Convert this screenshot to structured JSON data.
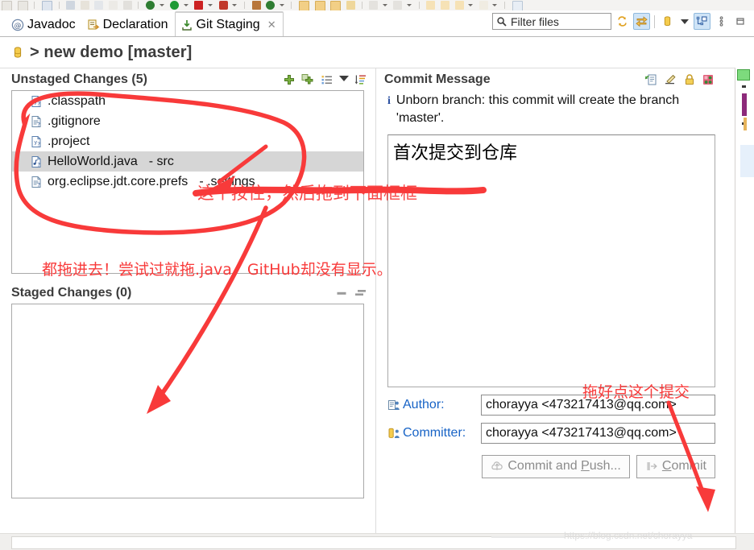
{
  "global_toolbar": {
    "name": "eclipse-main-toolbar",
    "icons": [
      "save-icon",
      "save-all-icon",
      "search-icon",
      "debug-icon",
      "run-last-icon",
      "external-tools-icon",
      "new-java-class-icon",
      "new-package-icon",
      "pause-icon",
      "git-push-icon",
      "run-icon",
      "coverage-icon",
      "debug-red-icon",
      "open-book-icon",
      "validate-icon",
      "folder-icon",
      "folder-icon-2",
      "folder-icon-3",
      "pencil-icon",
      "new-wizard-icon",
      "next-annotation-icon",
      "back-icon",
      "forward-icon",
      "forward-2-icon",
      "jump-icon",
      "new-window-icon"
    ]
  },
  "tabs": [
    {
      "label": "Javadoc",
      "icon": "javadoc-icon",
      "active": false,
      "closable": false
    },
    {
      "label": "Declaration",
      "icon": "declaration-icon",
      "active": false,
      "closable": false
    },
    {
      "label": "Git Staging",
      "icon": "git-staging-icon",
      "active": true,
      "closable": true
    }
  ],
  "tab_close_glyph": "✕",
  "view_toolbar": {
    "filter": {
      "value": "Filter files",
      "placeholder": "Filter files",
      "icon": "search-icon"
    },
    "buttons": [
      {
        "name": "refresh-icon",
        "label": "Refresh",
        "toggled": false
      },
      {
        "name": "link-selection-icon",
        "label": "Link with Editor and Selection",
        "toggled": true
      },
      {
        "name": "repository-icon",
        "label": "Repository",
        "toggled": false
      },
      {
        "name": "repository-dropdown-caret",
        "label": "Select repository",
        "toggled": false
      },
      {
        "name": "presentation-icon",
        "label": "Presentation",
        "toggled": true
      },
      {
        "name": "view-menu-icon",
        "label": "View Menu",
        "toggled": false
      },
      {
        "name": "minimize-view-icon",
        "label": "Minimize",
        "toggled": false
      }
    ]
  },
  "repository": {
    "icon": "repository-icon",
    "separator": ">",
    "name": "new demo",
    "branch": "[master]",
    "title": "> new demo [master]"
  },
  "unstaged": {
    "title": "Unstaged Changes (5)",
    "count": 5,
    "tools": [
      {
        "name": "add-to-index-icon",
        "label": "Add selected files to the index"
      },
      {
        "name": "add-all-to-index-icon",
        "label": "Add all files to the index"
      },
      {
        "name": "list-presentation-icon",
        "label": "Presentation"
      },
      {
        "name": "presentation-dropdown-caret",
        "label": "Presentation menu"
      },
      {
        "name": "sort-icon",
        "label": "Sort"
      }
    ],
    "files": [
      {
        "name": ".classpath",
        "path": "",
        "icon": "xml-file-icon",
        "selected": false
      },
      {
        "name": ".gitignore",
        "path": "",
        "icon": "text-file-icon",
        "selected": false
      },
      {
        "name": ".project",
        "path": "",
        "icon": "xml-file-icon",
        "selected": false
      },
      {
        "name": "HelloWorld.java",
        "path": "- src",
        "icon": "java-file-icon",
        "selected": true
      },
      {
        "name": "org.eclipse.jdt.core.prefs",
        "path": "- .settings",
        "icon": "text-file-icon",
        "selected": false
      }
    ]
  },
  "staged": {
    "title": "Staged Changes (0)",
    "count": 0,
    "tools": [
      {
        "name": "remove-from-index-icon",
        "label": "Remove selected files from the index"
      },
      {
        "name": "remove-all-from-index-icon",
        "label": "Remove all files from the index"
      }
    ],
    "files": []
  },
  "commit_message": {
    "title": "Commit Message",
    "tools": [
      {
        "name": "amend-commit-icon",
        "label": "Amend previous commit"
      },
      {
        "name": "sign-off-icon",
        "label": "Add Signed-off-by"
      },
      {
        "name": "sign-commit-icon",
        "label": "Sign commit"
      },
      {
        "name": "add-change-id-icon",
        "label": "Add Change-Id"
      }
    ],
    "info": {
      "icon": "info-icon",
      "text": "Unborn branch: this commit will create the branch 'master'."
    },
    "value": "首次提交到仓库",
    "placeholder": "Commit message"
  },
  "author": {
    "label": "Author:",
    "icon": "author-icon",
    "value": "chorayya <473217413@qq.com>",
    "placeholder": "Author"
  },
  "committer": {
    "label": "Committer:",
    "icon": "committer-icon",
    "value": "chorayya <473217413@qq.com>",
    "placeholder": "Committer"
  },
  "buttons": {
    "commit_and_push": {
      "prefix": "Commit and ",
      "mnemonic": "P",
      "suffix": "ush...",
      "full": "Commit and Push...",
      "icon": "push-icon"
    },
    "commit": {
      "prefix": "",
      "mnemonic": "C",
      "suffix": "ommit",
      "full": "Commit",
      "icon": "commit-icon"
    }
  },
  "annotations": [
    {
      "id": "annot-hold-drag",
      "text": "这个按住，然后拖到下面框框"
    },
    {
      "id": "annot-drag-all",
      "text": "都拖进去！尝试过就拖.java，GitHub却没有显示。"
    },
    {
      "id": "annot-click-commit",
      "text": "拖好点这个提交"
    }
  ],
  "annotation_color": "#f83a3a",
  "watermark": "https://blog.csdn.net/chorayya"
}
